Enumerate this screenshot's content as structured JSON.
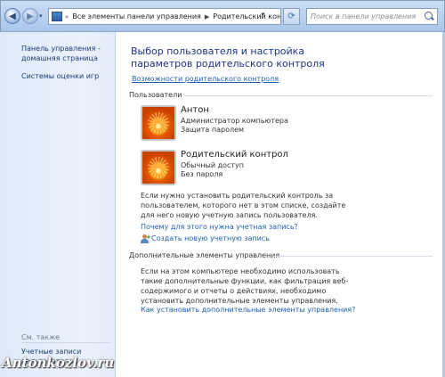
{
  "address_bar": {
    "breadcrumbs": [
      "Все элементы панели управления",
      "Родительский контроль"
    ],
    "search_placeholder": "Поиск в панели управления"
  },
  "sidebar": {
    "items": [
      {
        "label": "Панель управления -\nдомашняя страница"
      },
      {
        "label": "Системы оценки игр"
      }
    ],
    "see_also_label": "См. также",
    "see_also_items": [
      {
        "label": "Учетные записи\nпользователей"
      }
    ]
  },
  "main": {
    "title": "Выбор пользователя и настройка параметров родительского контроля",
    "top_link": "Возможности родительского контроля",
    "users_section": "Пользователи",
    "users": [
      {
        "name": "Антон",
        "lines": [
          "Администратор компьютера",
          "Защита паролем"
        ]
      },
      {
        "name": "Родительский контрол",
        "lines": [
          "Обычный доступ",
          "Без пароля"
        ]
      }
    ],
    "info_text": "Если нужно установить родительский контроль за пользователем, которого нет в этом списке, создайте для него новую учетную запись пользователя.",
    "why_link": "Почему для этого нужна учетная запись?",
    "create_link": "Создать новую учетную запись",
    "additional_section": "Дополнительные элементы управления",
    "additional_text": "Если на этом компьютере необходимо использовать такие дополнительные функции, как фильтрация веб-содержимого и отчеты о действиях, необходимо установить дополнительные элементы управления.",
    "install_link": "Как установить дополнительные элементы управления?"
  },
  "watermark": "Antonkozlov.ru",
  "colors": {
    "title": "#1e3287",
    "link": "#1f5fb0",
    "sidebar_bg": "#e3ecf9"
  }
}
